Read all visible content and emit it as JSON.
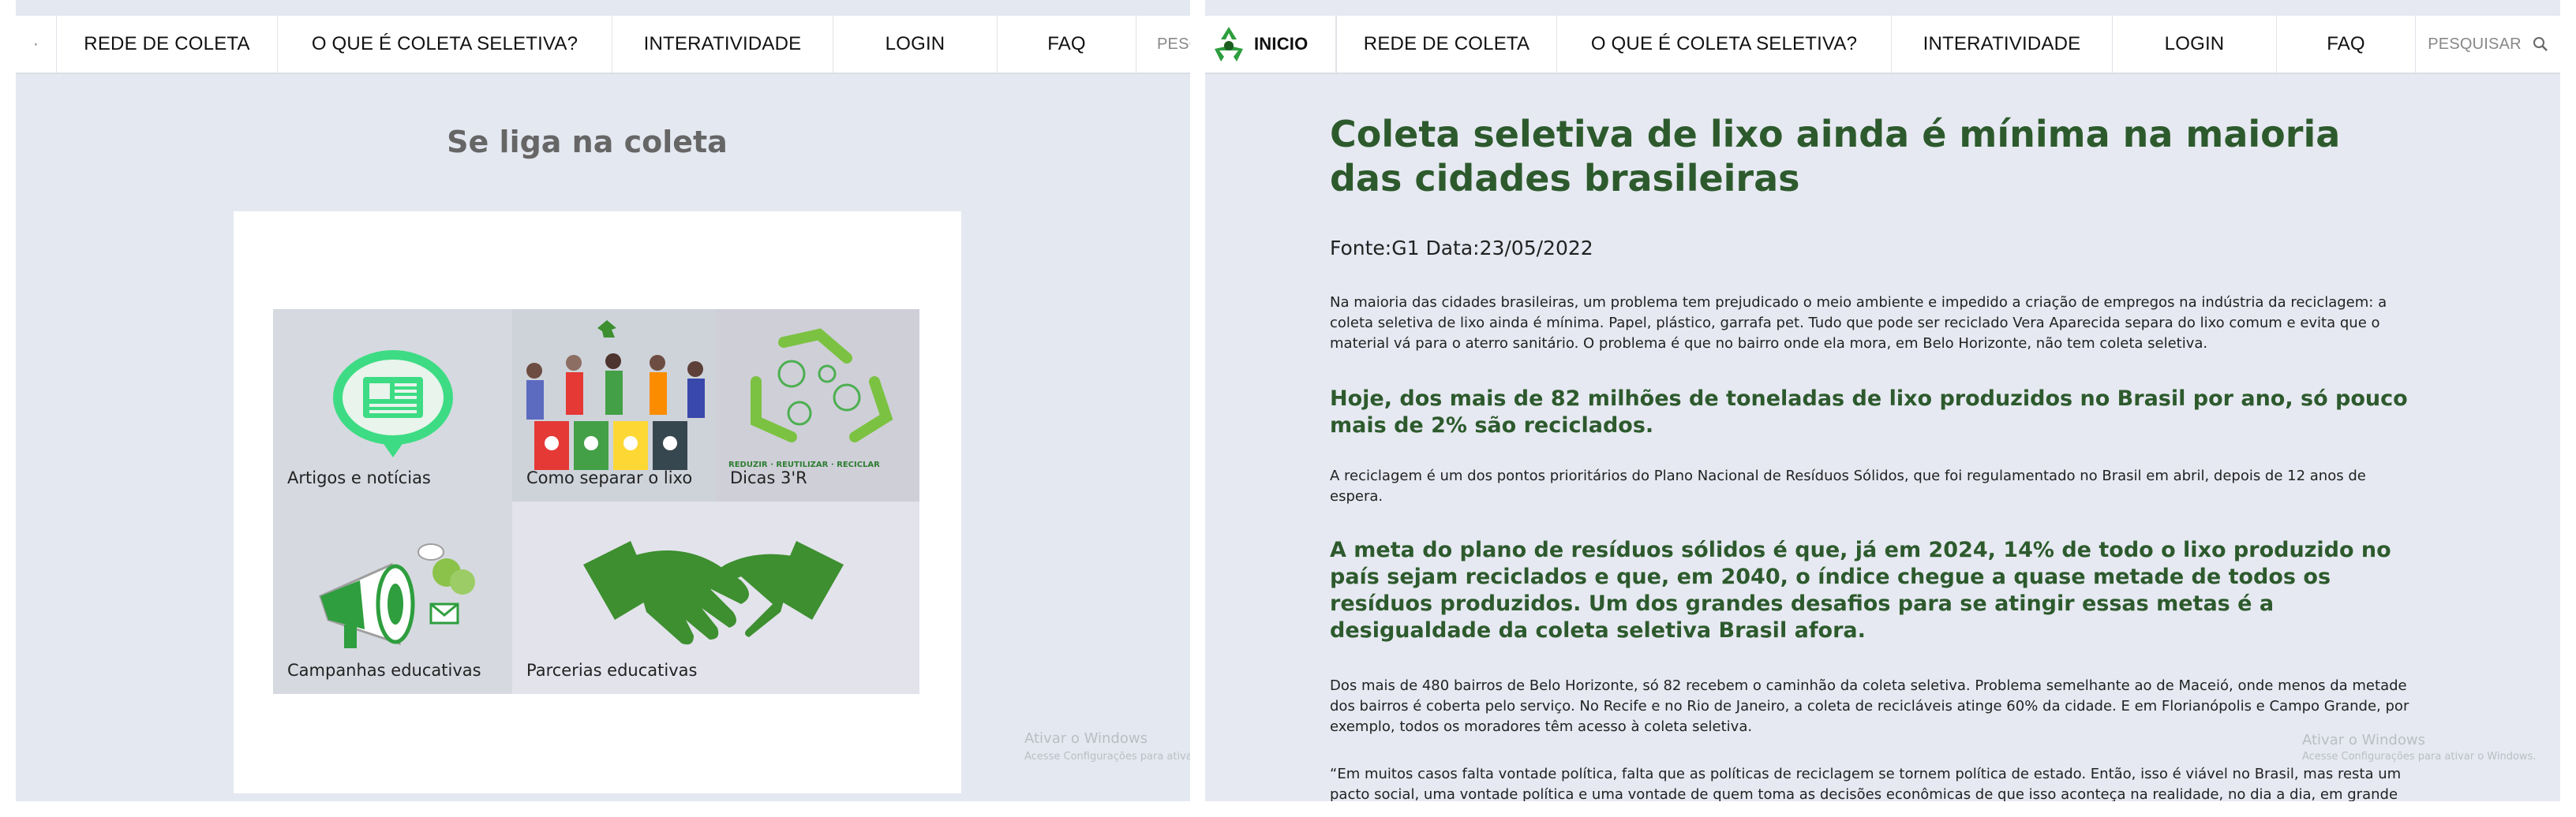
{
  "left_window": {
    "nav": {
      "partial_left": "·",
      "items": [
        "REDE DE COLETA",
        "O QUE É COLETA SELETIVA?",
        "INTERATIVIDADE",
        "LOGIN",
        "FAQ"
      ],
      "search_partial": "PESC"
    },
    "page_title": "Se liga na coleta",
    "tiles": [
      {
        "label": "Artigos e notícias",
        "icon": "news-chat-icon"
      },
      {
        "label": "Como separar o lixo",
        "icon": "recycling-people-icon"
      },
      {
        "label": "Dicas 3'R",
        "icon": "recycle-3r-icon",
        "caption": "REDUZIR · REUTILIZAR · RECICLAR"
      },
      {
        "label": "Campanhas educativas",
        "icon": "megaphone-icon"
      },
      {
        "label": "Parcerias educativas",
        "icon": "handshake-icon"
      }
    ],
    "watermark": {
      "title": "Ativar o Windows",
      "subtitle": "Acesse Configurações para ativar o"
    }
  },
  "right_window": {
    "nav": {
      "logo_label": "INICIO",
      "items": [
        "REDE DE COLETA",
        "O QUE É COLETA SELETIVA?",
        "INTERATIVIDADE",
        "LOGIN",
        "FAQ"
      ],
      "search_label": "PESQUISAR",
      "search_icon": "search-icon"
    },
    "article": {
      "title": "Coleta seletiva de lixo ainda é mínima na maioria das cidades brasileiras",
      "source": "Fonte:G1 Data:23/05/2022",
      "p1": "Na maioria das cidades brasileiras, um problema tem prejudicado o meio ambiente e impedido a criação de empregos na indústria da reciclagem: a coleta seletiva de lixo ainda é mínima. Papel, plástico, garrafa pet. Tudo que pode ser reciclado Vera Aparecida separa do lixo comum e evita que o material vá para o aterro sanitário. O problema é que no bairro onde ela mora, em Belo Horizonte, não tem coleta seletiva.",
      "h1": "Hoje, dos mais de 82 milhões de toneladas de lixo produzidos no Brasil por ano, só pouco mais de 2% são reciclados.",
      "p2": "A reciclagem é um dos pontos prioritários do Plano Nacional de Resíduos Sólidos, que foi regulamentado no Brasil em abril, depois de 12 anos de espera.",
      "h2": "A meta do plano de resíduos sólidos é que, já em 2024, 14% de todo o lixo produzido no país sejam reciclados e que, em 2040, o índice chegue a quase metade de todos os resíduos produzidos. Um dos grandes desafios para se atingir essas metas é a desigualdade da coleta seletiva Brasil afora.",
      "p3": "Dos mais de 480 bairros de Belo Horizonte, só 82 recebem o caminhão da coleta seletiva. Problema semelhante ao de Maceió, onde menos da metade dos bairros é coberta pelo serviço. No Recife e no Rio de Janeiro, a coleta de recicláveis atinge 60% da cidade. E em Florianópolis e Campo Grande, por exemplo, todos os moradores têm acesso à coleta seletiva.",
      "p4": "“Em muitos casos falta vontade política, falta que as políticas de reciclagem se tornem política de estado. Então, isso é viável no Brasil, mas resta um pacto social, uma vontade política e uma vontade de quem toma as decisões econômicas de que isso aconteça na realidade, no dia a dia, em grande escala”, diz Armindo Teodósio, professor de Sustentabilidade e Políticas Públicas da PUC Minas."
    },
    "watermark": {
      "title": "Ativar o Windows",
      "subtitle": "Acesse Configurações para ativar o Windows."
    }
  },
  "colors": {
    "accent_green": "#2d5a2d",
    "icon_green": "#3d8f2f",
    "panel_bg": "#e4e8f0"
  }
}
